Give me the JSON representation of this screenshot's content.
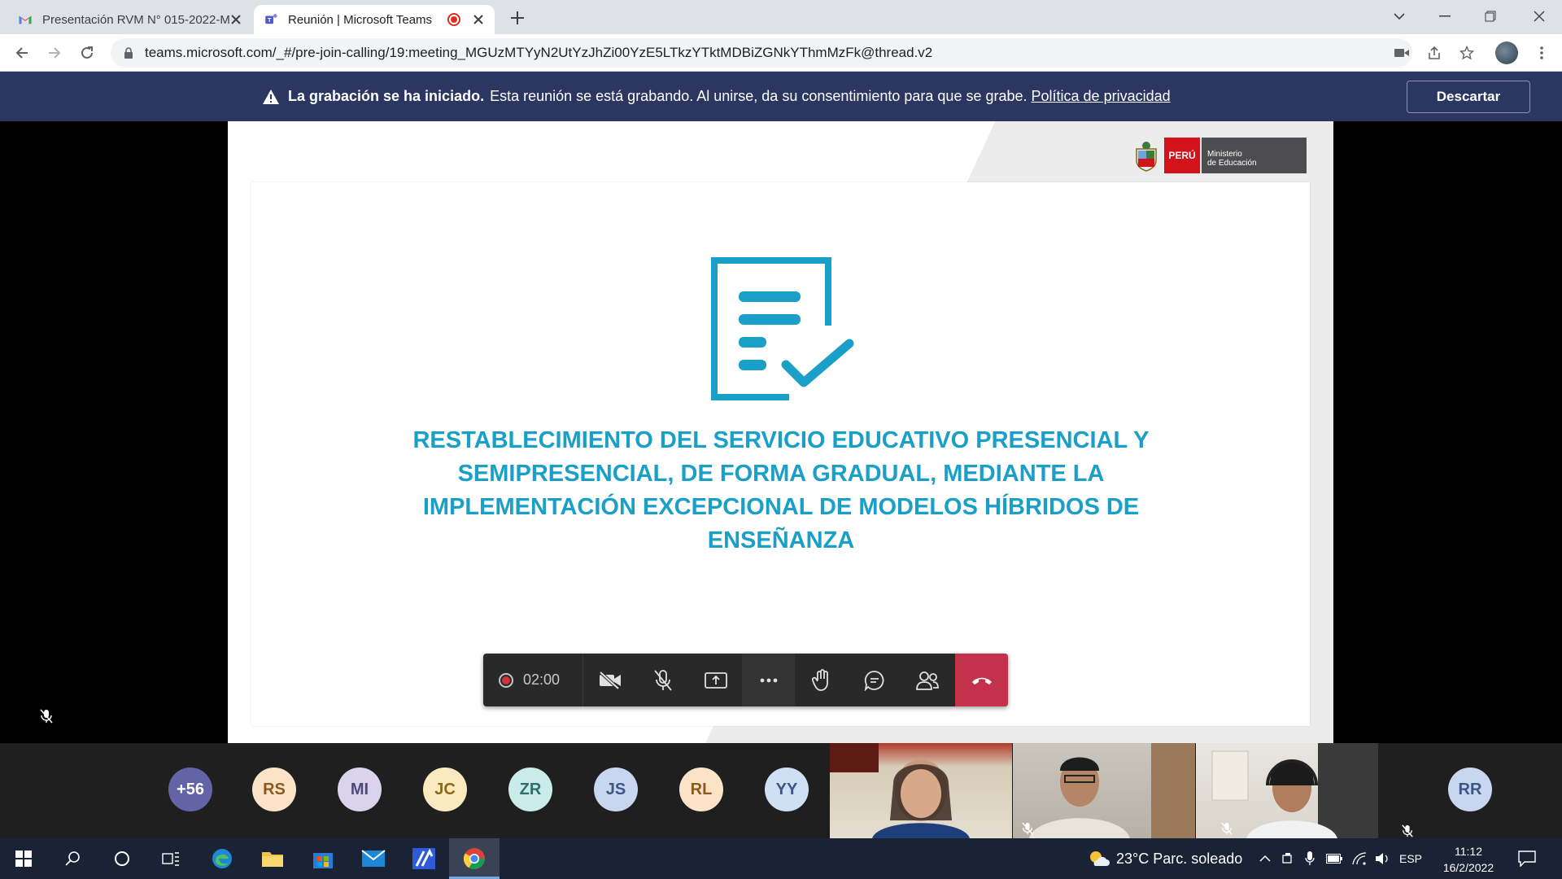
{
  "browser": {
    "tabs": [
      {
        "title": "Presentación RVM N° 015-2022-M",
        "icon": "gmail-icon"
      },
      {
        "title": "Reunión | Microsoft Teams",
        "icon": "teams-icon",
        "recording": true
      }
    ],
    "url": "teams.microsoft.com/_#/pre-join-calling/19:meeting_MGUzMTYyN2UtYzJhZi00YzE5LTkzYTktMDBiZGNkYThmMzFk@thread.v2"
  },
  "banner": {
    "bold": "La grabación se ha iniciado.",
    "text": "Esta reunión se está grabando. Al unirse, da su consentimiento para que se grabe.",
    "link": "Política de privacidad",
    "dismiss": "Descartar"
  },
  "slide": {
    "logo_country": "PERÚ",
    "logo_line1": "Ministerio",
    "logo_line2": "de Educación",
    "title": "RESTABLECIMIENTO DEL SERVICIO EDUCATIVO PRESENCIAL Y SEMIPRESENCIAL, DE FORMA GRADUAL, MEDIANTE LA IMPLEMENTACIÓN EXCEPCIONAL DE MODELOS HÍBRIDOS DE ENSEÑANZA",
    "accent_color": "#1aa0c8"
  },
  "controls": {
    "timer": "02:00",
    "hangup_color": "#c4314b"
  },
  "participants": {
    "overflow": "+56",
    "avatars": [
      {
        "initials": "RS",
        "bg": "#fbe3c8",
        "fg": "#8a5a1f"
      },
      {
        "initials": "MI",
        "bg": "#d9d3ec",
        "fg": "#4f4a7a"
      },
      {
        "initials": "JC",
        "bg": "#fbe9c0",
        "fg": "#8a6a18"
      },
      {
        "initials": "ZR",
        "bg": "#c9ecea",
        "fg": "#2f6e6a"
      },
      {
        "initials": "JS",
        "bg": "#c8d6f0",
        "fg": "#3b5687"
      },
      {
        "initials": "RL",
        "bg": "#fbe3c8",
        "fg": "#8a5a1f"
      },
      {
        "initials": "YY",
        "bg": "#cfe0f5",
        "fg": "#3b5687"
      }
    ],
    "last": {
      "initials": "RR",
      "bg": "#c8d6f0",
      "fg": "#3b5687"
    }
  },
  "taskbar": {
    "weather": "23°C  Parc. soleado",
    "lang": "ESP",
    "time": "11:12",
    "date": "16/2/2022"
  }
}
